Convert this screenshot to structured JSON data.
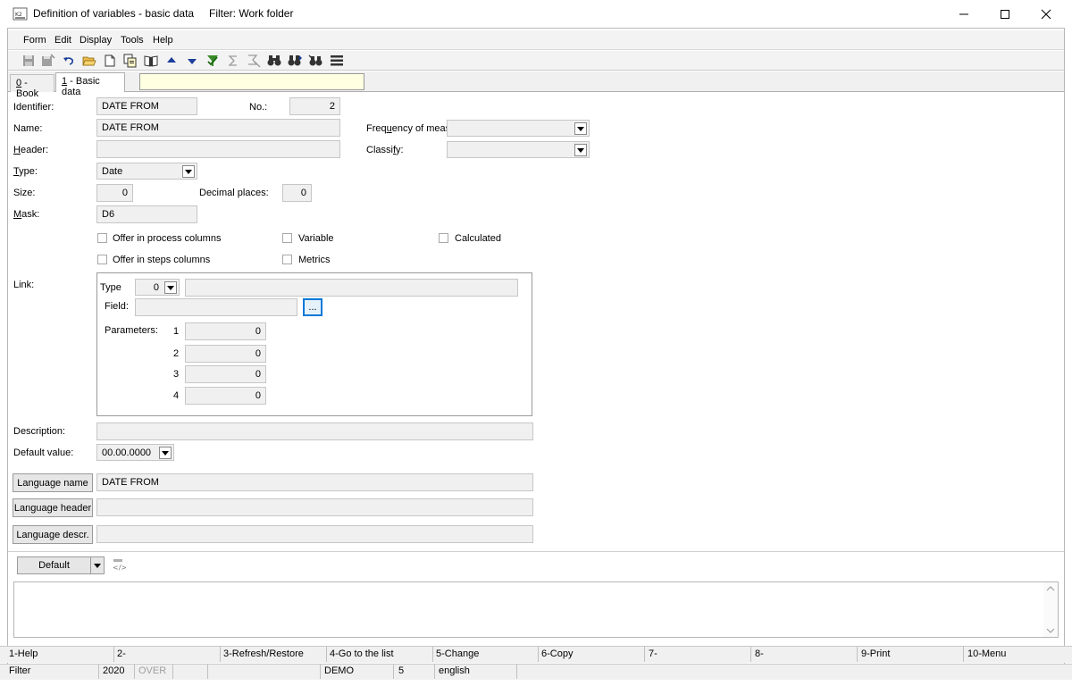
{
  "window": {
    "title": "Definition of variables - basic data",
    "filter_title": "Filter: Work folder"
  },
  "menu": [
    "Form",
    "Edit",
    "Display",
    "Tools",
    "Help"
  ],
  "tabs": {
    "book": "0 - Book",
    "book_key": "0",
    "book_rest": " - Book",
    "basic_key": "1",
    "basic_rest": " - Basic data"
  },
  "labels": {
    "identifier": "Identifier:",
    "no": "No.:",
    "name": "Name:",
    "header_h": "H",
    "header_rest": "eader:",
    "type_t": "T",
    "type_rest": "ype:",
    "size": "Size:",
    "decimal": "Decimal places:",
    "mask_m": "M",
    "mask_rest": "ask:",
    "frequency_pre": "Freq",
    "frequency_u": "u",
    "frequency_post": "ency of meas",
    "classify_pre": "Classi",
    "classify_u": "f",
    "classify_post": "y:",
    "link": "Link:",
    "link_type": "Type",
    "field": "Field:",
    "parameters": "Parameters:",
    "description": "Description:",
    "default_value": "Default value:"
  },
  "values": {
    "identifier": "DATE FROM",
    "no": "2",
    "name": "DATE FROM",
    "header": "",
    "type": "Date",
    "size": "0",
    "decimal": "0",
    "mask": "D6",
    "frequency": "",
    "classify": "",
    "link_type": "0",
    "link_type_desc": "",
    "field": "",
    "params": [
      {
        "index": "1",
        "value": "0"
      },
      {
        "index": "2",
        "value": "0"
      },
      {
        "index": "3",
        "value": "0"
      },
      {
        "index": "4",
        "value": "0"
      }
    ],
    "description": "",
    "default_value": "00.00.0000",
    "language_name": "DATE FROM",
    "language_header": "",
    "language_descr": ""
  },
  "checkboxes": {
    "offer_process": "Offer in process columns",
    "offer_steps": "Offer in steps columns",
    "variable": "Variable",
    "metrics": "Metrics",
    "calculated": "Calculated"
  },
  "buttons": {
    "language_name": "Language name",
    "language_header": "Language header",
    "language_descr": "Language descr.",
    "default": "Default",
    "ellipsis": "..."
  },
  "fkeys": [
    "1-Help",
    "2-",
    "3-Refresh/Restore",
    "4-Go to the list",
    "5-Change",
    "6-Copy",
    "7-",
    "8-",
    "9-Print",
    "10-Menu"
  ],
  "status": {
    "filter": "Filter",
    "year": "2020",
    "over": "OVER",
    "demo": "DEMO",
    "number": "5",
    "language": "english"
  },
  "colors": {
    "field_bg": "#f0f0f0",
    "tab_search_bg": "#ffffe1",
    "ellipsis_border": "#0078d7"
  }
}
